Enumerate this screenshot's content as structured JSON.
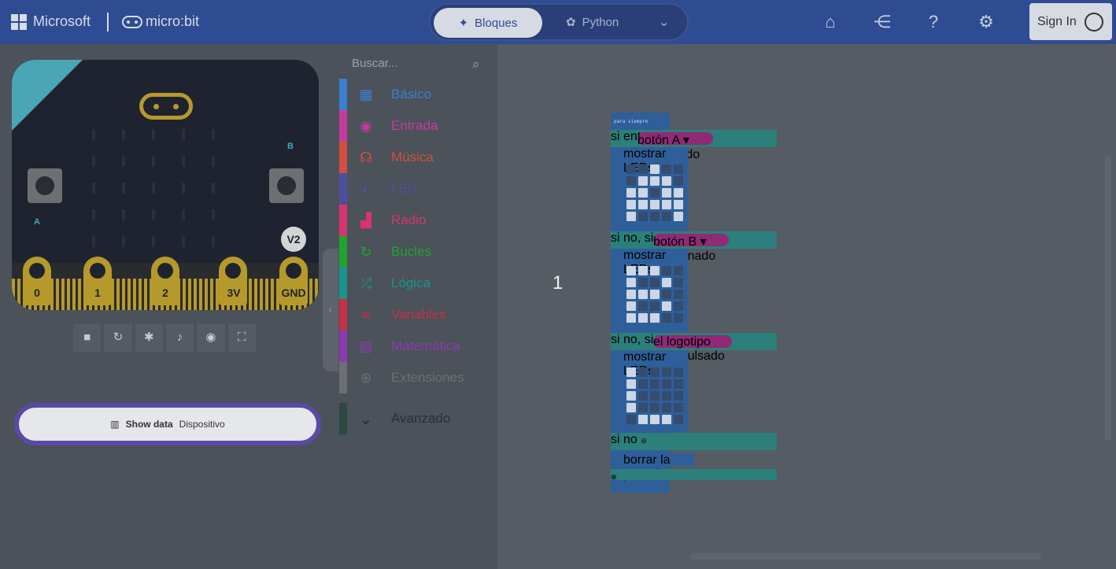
{
  "header": {
    "microsoft_label": "Microsoft",
    "microbit_label": "micro:bit",
    "mode_blocks": "Bloques",
    "mode_python": "Python",
    "signin_label": "Sign In"
  },
  "simulator": {
    "label_a": "A",
    "label_b": "B",
    "badge": "V2",
    "pins": [
      "0",
      "1",
      "2",
      "3V",
      "GND"
    ],
    "show_data": "Show data",
    "show_data_source": "Dispositivo"
  },
  "toolbox": {
    "search_placeholder": "Buscar...",
    "categories": [
      {
        "label": "Básico",
        "color": "#3b7fd1",
        "icon": "grid-icon"
      },
      {
        "label": "Entrada",
        "color": "#c43b9f",
        "icon": "target-icon"
      },
      {
        "label": "Música",
        "color": "#d34e3c",
        "icon": "headphones-icon"
      },
      {
        "label": "LED",
        "color": "#4d4fa0",
        "icon": "toggle-icon"
      },
      {
        "label": "Radio",
        "color": "#d6346e",
        "icon": "signal-icon"
      },
      {
        "label": "Bucles",
        "color": "#1fa52e",
        "icon": "refresh-icon"
      },
      {
        "label": "Lógica",
        "color": "#17958d",
        "icon": "shuffle-icon"
      },
      {
        "label": "Variables",
        "color": "#c43047",
        "icon": "list-icon"
      },
      {
        "label": "Matemática",
        "color": "#8c3ab1",
        "icon": "calculator-icon"
      },
      {
        "label": "Extensiones",
        "color": "#6e6f72",
        "icon": "plus-circle-icon"
      }
    ],
    "advanced": "Avanzado"
  },
  "workspace": {
    "counter": "1",
    "blocks": {
      "forever": "para siempre",
      "if_label": "si",
      "cond1": "botón A ▾ presionado",
      "then_label": "entonces",
      "show_leds": "mostrar LEDs",
      "else_if_label": "si no, si",
      "cond2": "botón B ▾ presionado",
      "cond3": "el logotipo está pulsado",
      "else_label": "si no",
      "clear": "borrar la pantalla"
    },
    "led_patterns": [
      [
        0,
        0,
        1,
        0,
        0,
        0,
        1,
        1,
        1,
        0,
        1,
        1,
        0,
        1,
        1,
        1,
        1,
        1,
        1,
        1,
        1,
        0,
        0,
        0,
        1
      ],
      [
        1,
        1,
        1,
        0,
        0,
        1,
        0,
        0,
        1,
        0,
        1,
        1,
        1,
        0,
        0,
        1,
        0,
        0,
        1,
        0,
        1,
        1,
        1,
        0,
        0
      ],
      [
        1,
        0,
        0,
        0,
        0,
        1,
        0,
        0,
        0,
        0,
        1,
        0,
        0,
        0,
        0,
        1,
        0,
        0,
        0,
        0,
        0,
        1,
        1,
        1,
        0
      ]
    ]
  }
}
